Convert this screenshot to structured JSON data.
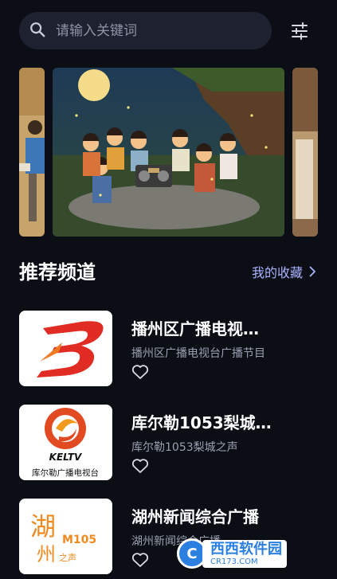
{
  "search": {
    "placeholder": "请输入关键词"
  },
  "section": {
    "title": "推荐频道",
    "favorites_label": "我的收藏"
  },
  "channels": [
    {
      "title": "播州区广播电视…",
      "subtitle": "播州区广播电视台广播节目"
    },
    {
      "title": "库尔勒1053梨城…",
      "subtitle": "库尔勒1053梨城之声",
      "logo_text": "KELTV",
      "logo_caption": "库尔勒广播电视台"
    },
    {
      "title": "湖州新闻综合广播",
      "subtitle": "湖州新闻综合广播",
      "logo_char1": "湖",
      "logo_char2": "州",
      "logo_brand": "M105",
      "logo_slogan": "之声"
    }
  ],
  "watermark": {
    "badge": "C",
    "text": "西西软件园",
    "sub": "CR173.COM"
  },
  "colors": {
    "background": "#0c0e16",
    "accent": "#a8b4ff",
    "search_bg": "#1e2130"
  },
  "icons": {
    "search": "search-icon",
    "filter": "sliders-icon",
    "chevron": "chevron-right-icon",
    "heart": "heart-outline-icon"
  }
}
